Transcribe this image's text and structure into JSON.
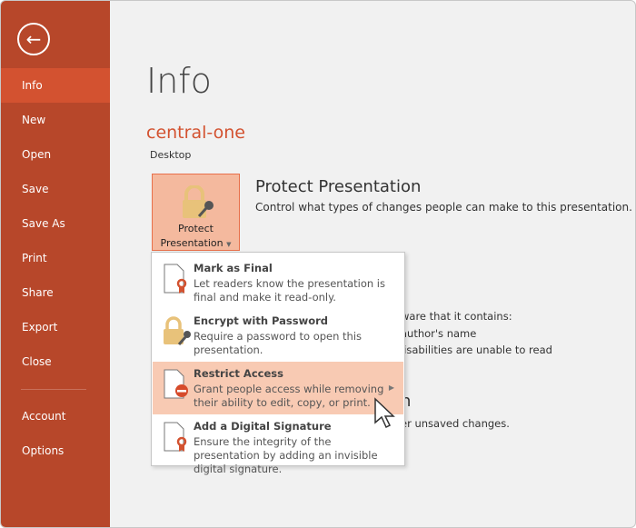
{
  "sidebar": {
    "back": "back-arrow-icon",
    "items": [
      {
        "label": "Info",
        "active": true
      },
      {
        "label": "New"
      },
      {
        "label": "Open"
      },
      {
        "label": "Save"
      },
      {
        "label": "Save As"
      },
      {
        "label": "Print"
      },
      {
        "label": "Share"
      },
      {
        "label": "Export"
      },
      {
        "label": "Close"
      },
      {
        "label": "Account"
      },
      {
        "label": "Options"
      }
    ]
  },
  "main": {
    "title": "Info",
    "file_name": "central-one",
    "location": "Desktop",
    "protect": {
      "button_line1": "Protect",
      "button_line2": "Presentation",
      "heading": "Protect Presentation",
      "description": "Control what types of changes people can make to this presentation."
    },
    "background_fragments": [
      "ware that it contains:",
      "author's name",
      "lisabilities are unable to read",
      "n",
      "er unsaved changes."
    ]
  },
  "menu": {
    "items": [
      {
        "title": "Mark as Final",
        "desc": "Let readers know the presentation is final and make it read-only.",
        "icon": "document-ribbon-icon"
      },
      {
        "title": "Encrypt with Password",
        "desc": "Require a password to open this presentation.",
        "icon": "lock-key-icon"
      },
      {
        "title": "Restrict Access",
        "desc": "Grant people access while removing their ability to edit, copy, or print.",
        "icon": "document-restrict-icon",
        "highlighted": true
      },
      {
        "title": "Add a Digital Signature",
        "desc": "Ensure the integrity of the presentation by adding an invisible digital signature.",
        "icon": "document-ribbon-icon"
      }
    ]
  },
  "colors": {
    "sidebar": "#b7472a",
    "active": "#d35230",
    "highlight": "#f8cab3"
  }
}
